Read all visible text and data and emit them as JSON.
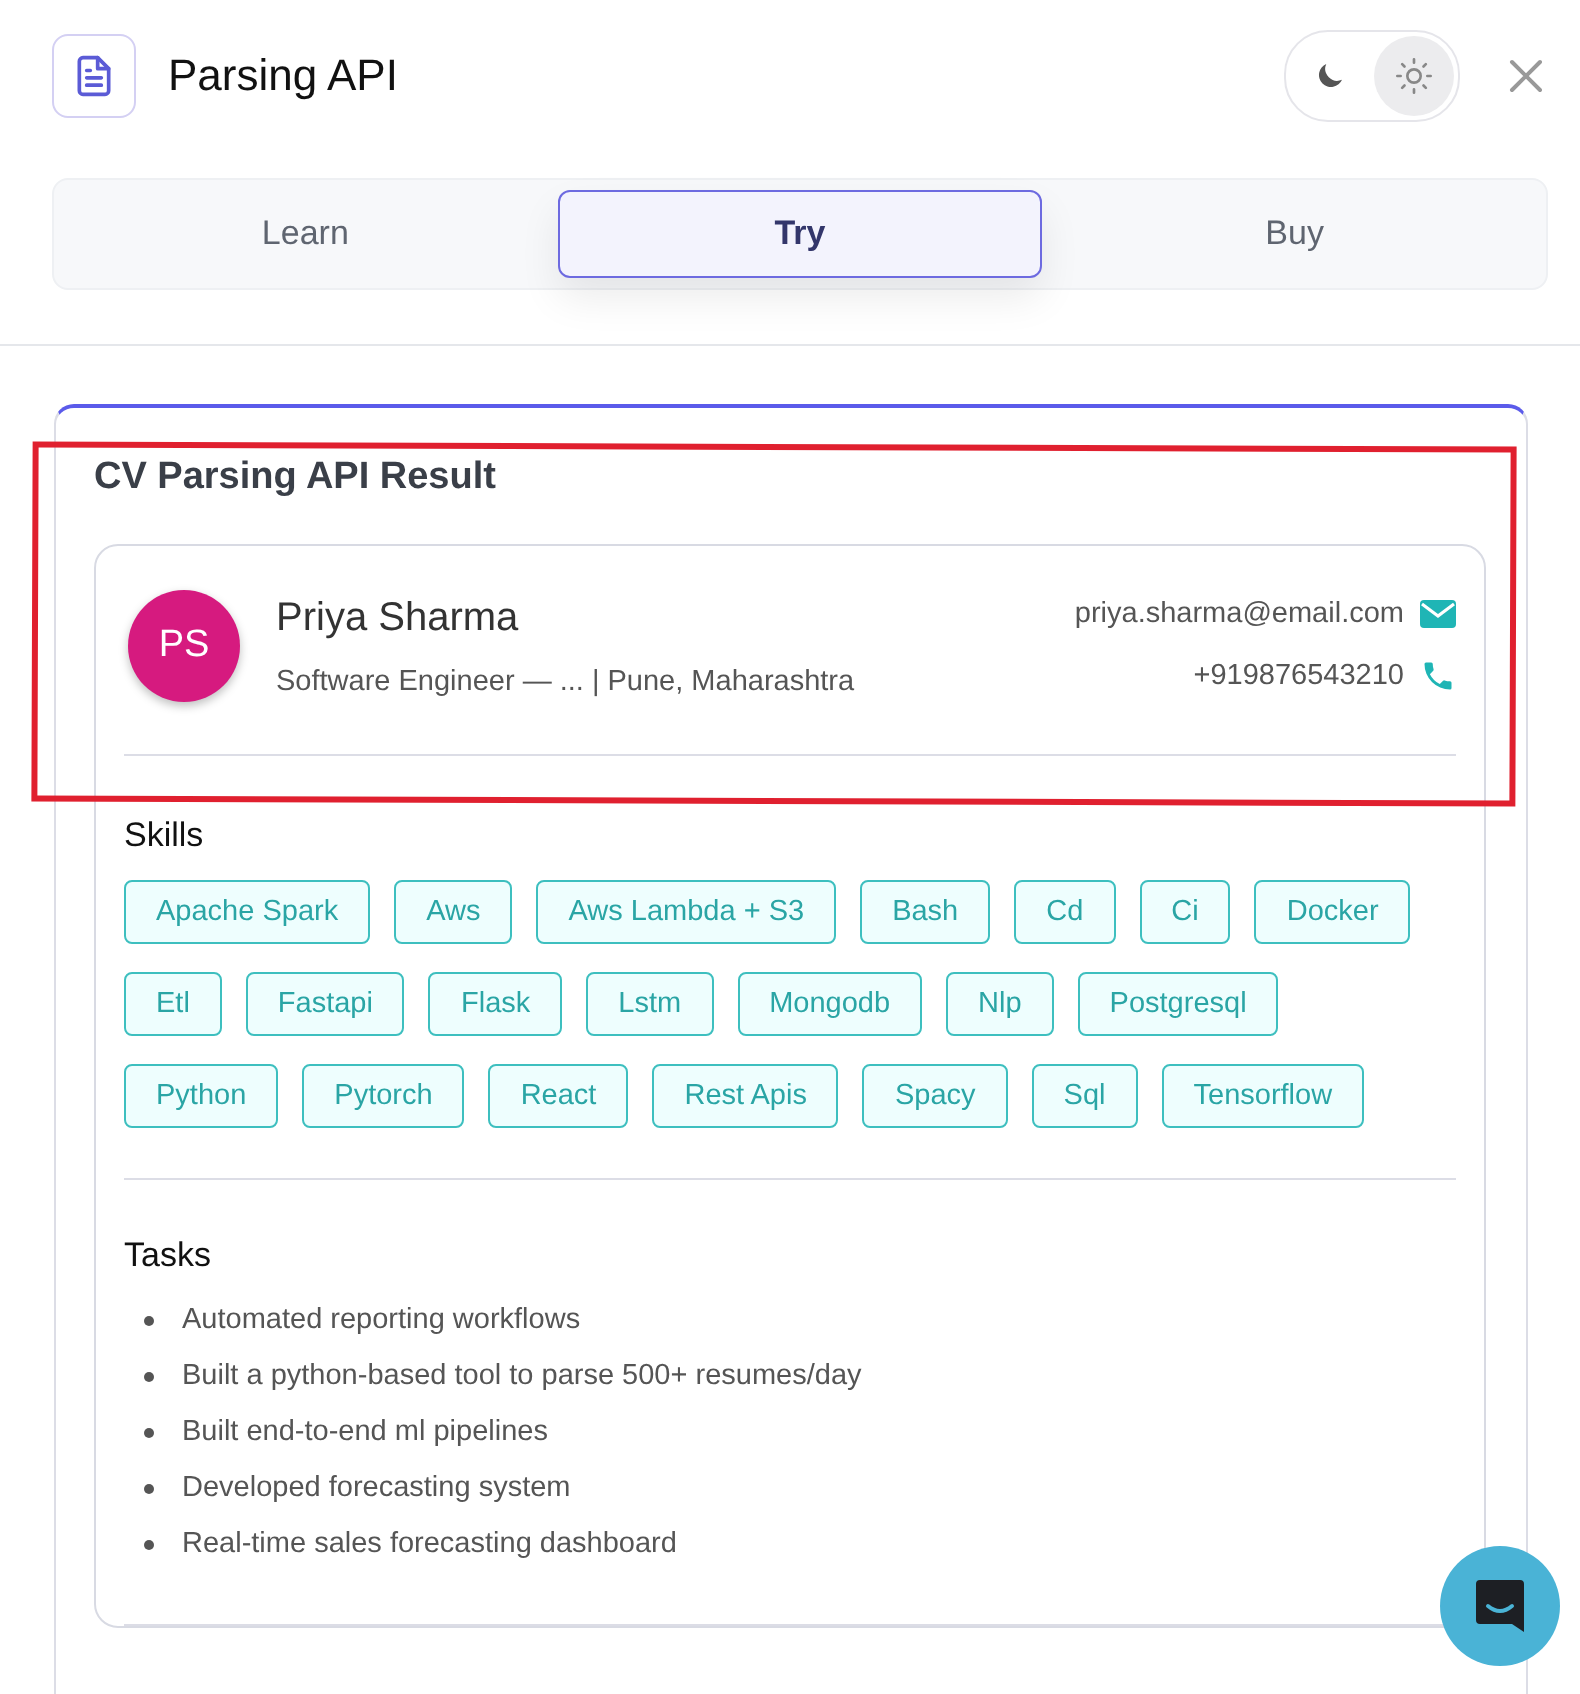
{
  "header": {
    "title": "Parsing API",
    "theme_toggle": [
      {
        "kind": "dark",
        "selected": false
      },
      {
        "kind": "light",
        "selected": true
      }
    ]
  },
  "tabs": [
    {
      "label": "Learn",
      "selected": false
    },
    {
      "label": "Try",
      "selected": true
    },
    {
      "label": "Buy",
      "selected": false
    }
  ],
  "result": {
    "title": "CV Parsing API Result",
    "profile": {
      "initials": "PS",
      "name": "Priya Sharma",
      "headline": "Software Engineer — ...  | Pune, Maharashtra",
      "email": "priya.sharma@email.com",
      "phone": "+919876543210"
    },
    "skills_heading": "Skills",
    "skills": [
      "Apache Spark",
      "Aws",
      "Aws Lambda + S3",
      "Bash",
      "Cd",
      "Ci",
      "Docker",
      "Etl",
      "Fastapi",
      "Flask",
      "Lstm",
      "Mongodb",
      "Nlp",
      "Postgresql",
      "Python",
      "Pytorch",
      "React",
      "Rest Apis",
      "Spacy",
      "Sql",
      "Tensorflow"
    ],
    "tasks_heading": "Tasks",
    "tasks": [
      "Automated reporting workflows",
      "Built a python-based tool to parse 500+ resumes/day",
      "Built end-to-end ml pipelines",
      "Developed forecasting system",
      "Real-time sales forecasting dashboard"
    ]
  }
}
